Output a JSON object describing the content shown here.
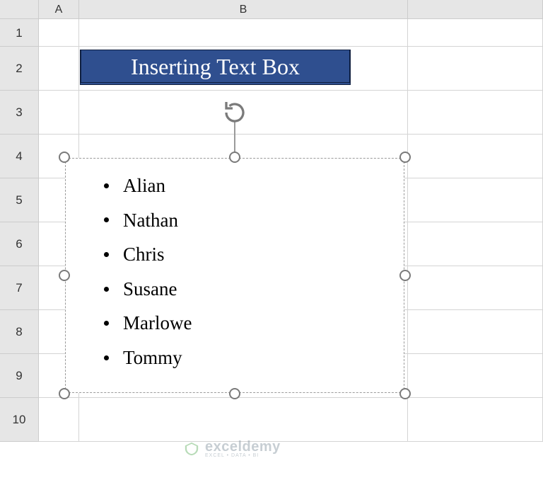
{
  "columns": {
    "A": "A",
    "B": "B"
  },
  "rows": [
    "1",
    "2",
    "3",
    "4",
    "5",
    "6",
    "7",
    "8",
    "9",
    "10"
  ],
  "title": "Inserting Text Box",
  "textbox": {
    "bullets": [
      "Alian",
      "Nathan",
      "Chris",
      "Susane",
      "Marlowe",
      "Tommy"
    ]
  },
  "watermark": {
    "brand": "exceldemy",
    "tagline": "EXCEL • DATA • BI"
  }
}
